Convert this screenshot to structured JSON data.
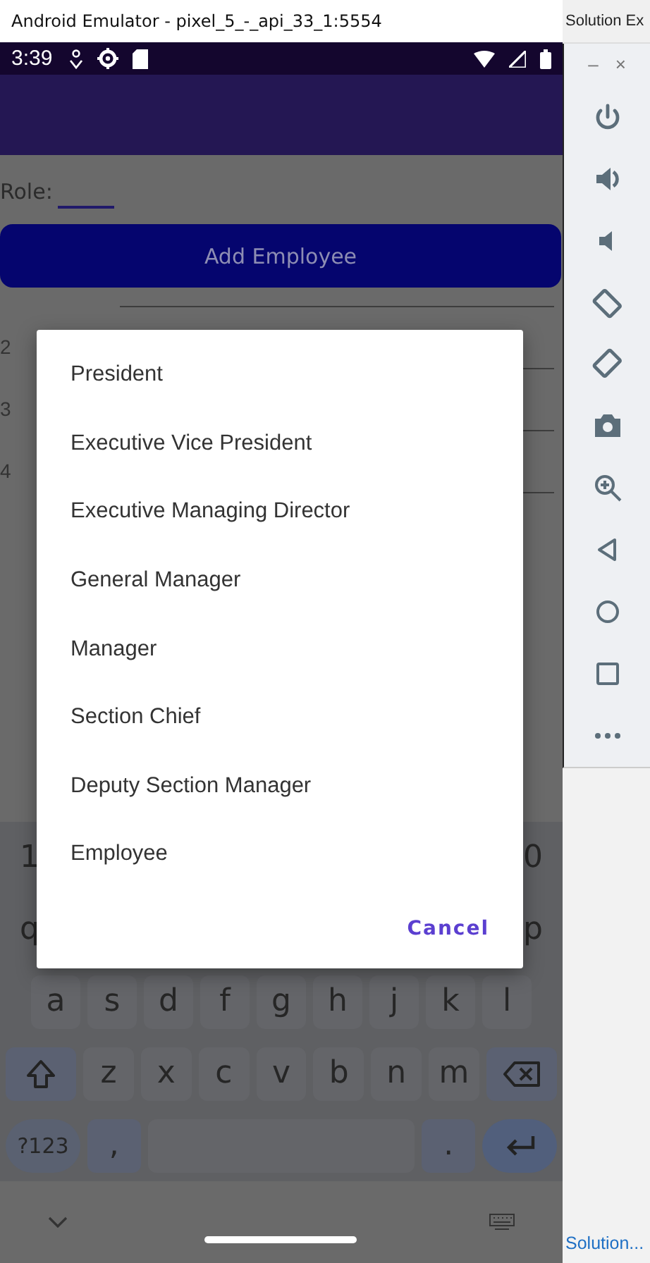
{
  "window": {
    "title": "Android Emulator - pixel_5_-_api_33_1:5554"
  },
  "side_tab": {
    "label": "Solution Ex"
  },
  "status_bar": {
    "time": "3:39"
  },
  "form": {
    "role_label": "Role:",
    "add_button": "Add Employee",
    "rows": [
      {
        "number": "2"
      },
      {
        "number": "3"
      },
      {
        "number": "4"
      }
    ]
  },
  "dialog": {
    "options": [
      "President",
      "Executive Vice President",
      "Executive Managing Director",
      "General Manager",
      "Manager",
      "Section Chief",
      "Deputy Section Manager",
      "Employee"
    ],
    "cancel": "Cancel"
  },
  "keyboard": {
    "rows": [
      {
        "keys": [
          {
            "kind": "char",
            "label": "1"
          },
          {
            "kind": "char",
            "label": "0"
          }
        ]
      },
      {
        "keys": [
          {
            "kind": "char",
            "label": "q"
          },
          {
            "kind": "char",
            "label": "p"
          }
        ]
      },
      {
        "keys": [
          {
            "kind": "char",
            "label": "a"
          },
          {
            "kind": "char",
            "label": "s"
          },
          {
            "kind": "char",
            "label": "d"
          },
          {
            "kind": "char",
            "label": "f"
          },
          {
            "kind": "char",
            "label": "g"
          },
          {
            "kind": "char",
            "label": "h"
          },
          {
            "kind": "char",
            "label": "j"
          },
          {
            "kind": "char",
            "label": "k"
          },
          {
            "kind": "char",
            "label": "l"
          }
        ]
      },
      {
        "keys": [
          {
            "kind": "shift"
          },
          {
            "kind": "char",
            "label": "z"
          },
          {
            "kind": "char",
            "label": "x"
          },
          {
            "kind": "char",
            "label": "c"
          },
          {
            "kind": "char",
            "label": "v"
          },
          {
            "kind": "char",
            "label": "b"
          },
          {
            "kind": "char",
            "label": "n"
          },
          {
            "kind": "char",
            "label": "m"
          },
          {
            "kind": "backspace"
          }
        ]
      },
      {
        "keys": [
          {
            "kind": "symbols",
            "label": "?123"
          },
          {
            "kind": "punct",
            "label": ","
          },
          {
            "kind": "space"
          },
          {
            "kind": "punct",
            "label": "."
          },
          {
            "kind": "enter"
          }
        ]
      }
    ]
  },
  "toolbar": {
    "minimize": "–",
    "close": "×"
  },
  "bottom_link": "Solution..."
}
